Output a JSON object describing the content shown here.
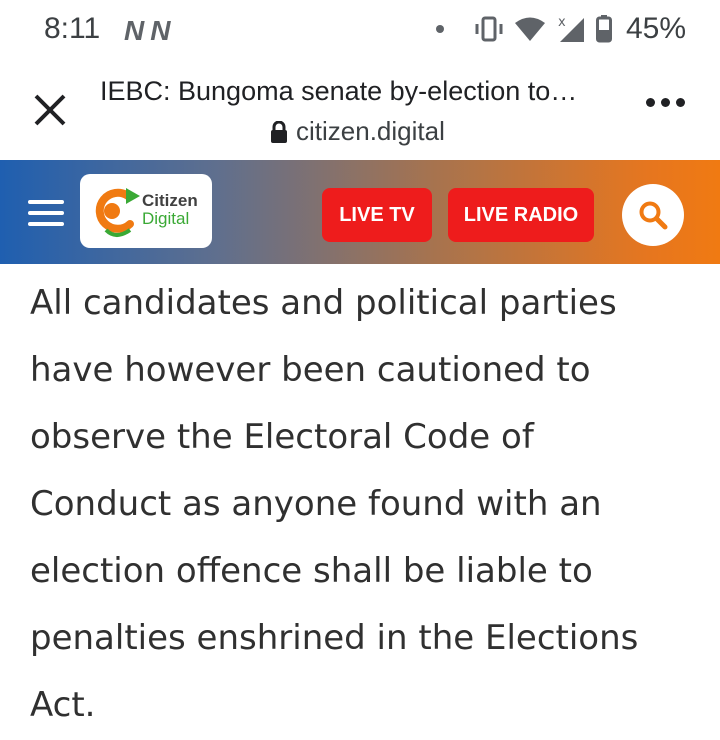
{
  "status_bar": {
    "time": "8:11",
    "notification_icons": [
      "N",
      "N"
    ],
    "battery": "45%"
  },
  "browser": {
    "title": "IEBC: Bungoma senate by-election to…",
    "url": "citizen.digital"
  },
  "site_header": {
    "logo_line1": "Citizen",
    "logo_line2": "Digital",
    "live_tv": "LIVE TV",
    "live_radio": "LIVE RADIO",
    "colors": {
      "live_button": "#ee1c1c",
      "gradient_start": "#1f5fb0",
      "gradient_end": "#f07a12",
      "logo_green": "#3aa935",
      "logo_orange": "#f07a12"
    }
  },
  "article": {
    "paragraph": "All candidates and political parties have however been cautioned to observe the Electoral Code of Conduct as anyone found with an election offence shall be liable to penalties enshrined in the Elections Act."
  }
}
